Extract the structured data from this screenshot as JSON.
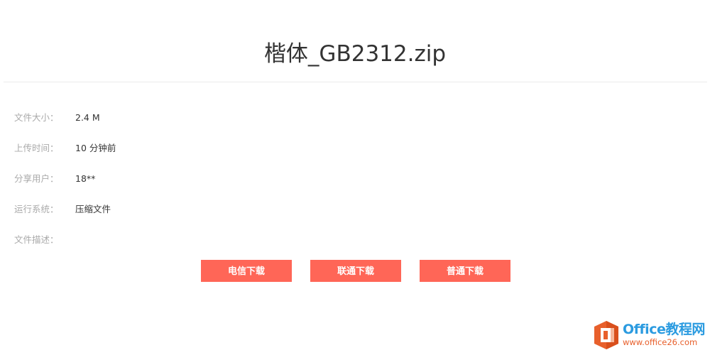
{
  "page": {
    "file_title": "楷体_GB2312.zip"
  },
  "info": [
    {
      "label": "文件大小：",
      "value": "2.4 M"
    },
    {
      "label": "上传时间：",
      "value": "10 分钟前"
    },
    {
      "label": "分享用户：",
      "value": "18**"
    },
    {
      "label": "运行系统：",
      "value": "压缩文件"
    },
    {
      "label": "文件描述：",
      "value": ""
    }
  ],
  "buttons": {
    "telecom_label": "电信下载",
    "unicom_label": "联通下载",
    "normal_label": "普通下载"
  },
  "watermark": {
    "icon": "office-logo-icon",
    "brand": "Office教程网",
    "url": "www.office26.com"
  },
  "colors": {
    "button_bg": "#ff6657",
    "button_text": "#ffffff",
    "label_text": "#aaaaaa",
    "value_text": "#333333",
    "watermark_logo": "#e8602c",
    "watermark_brand": "#2b9be0"
  }
}
